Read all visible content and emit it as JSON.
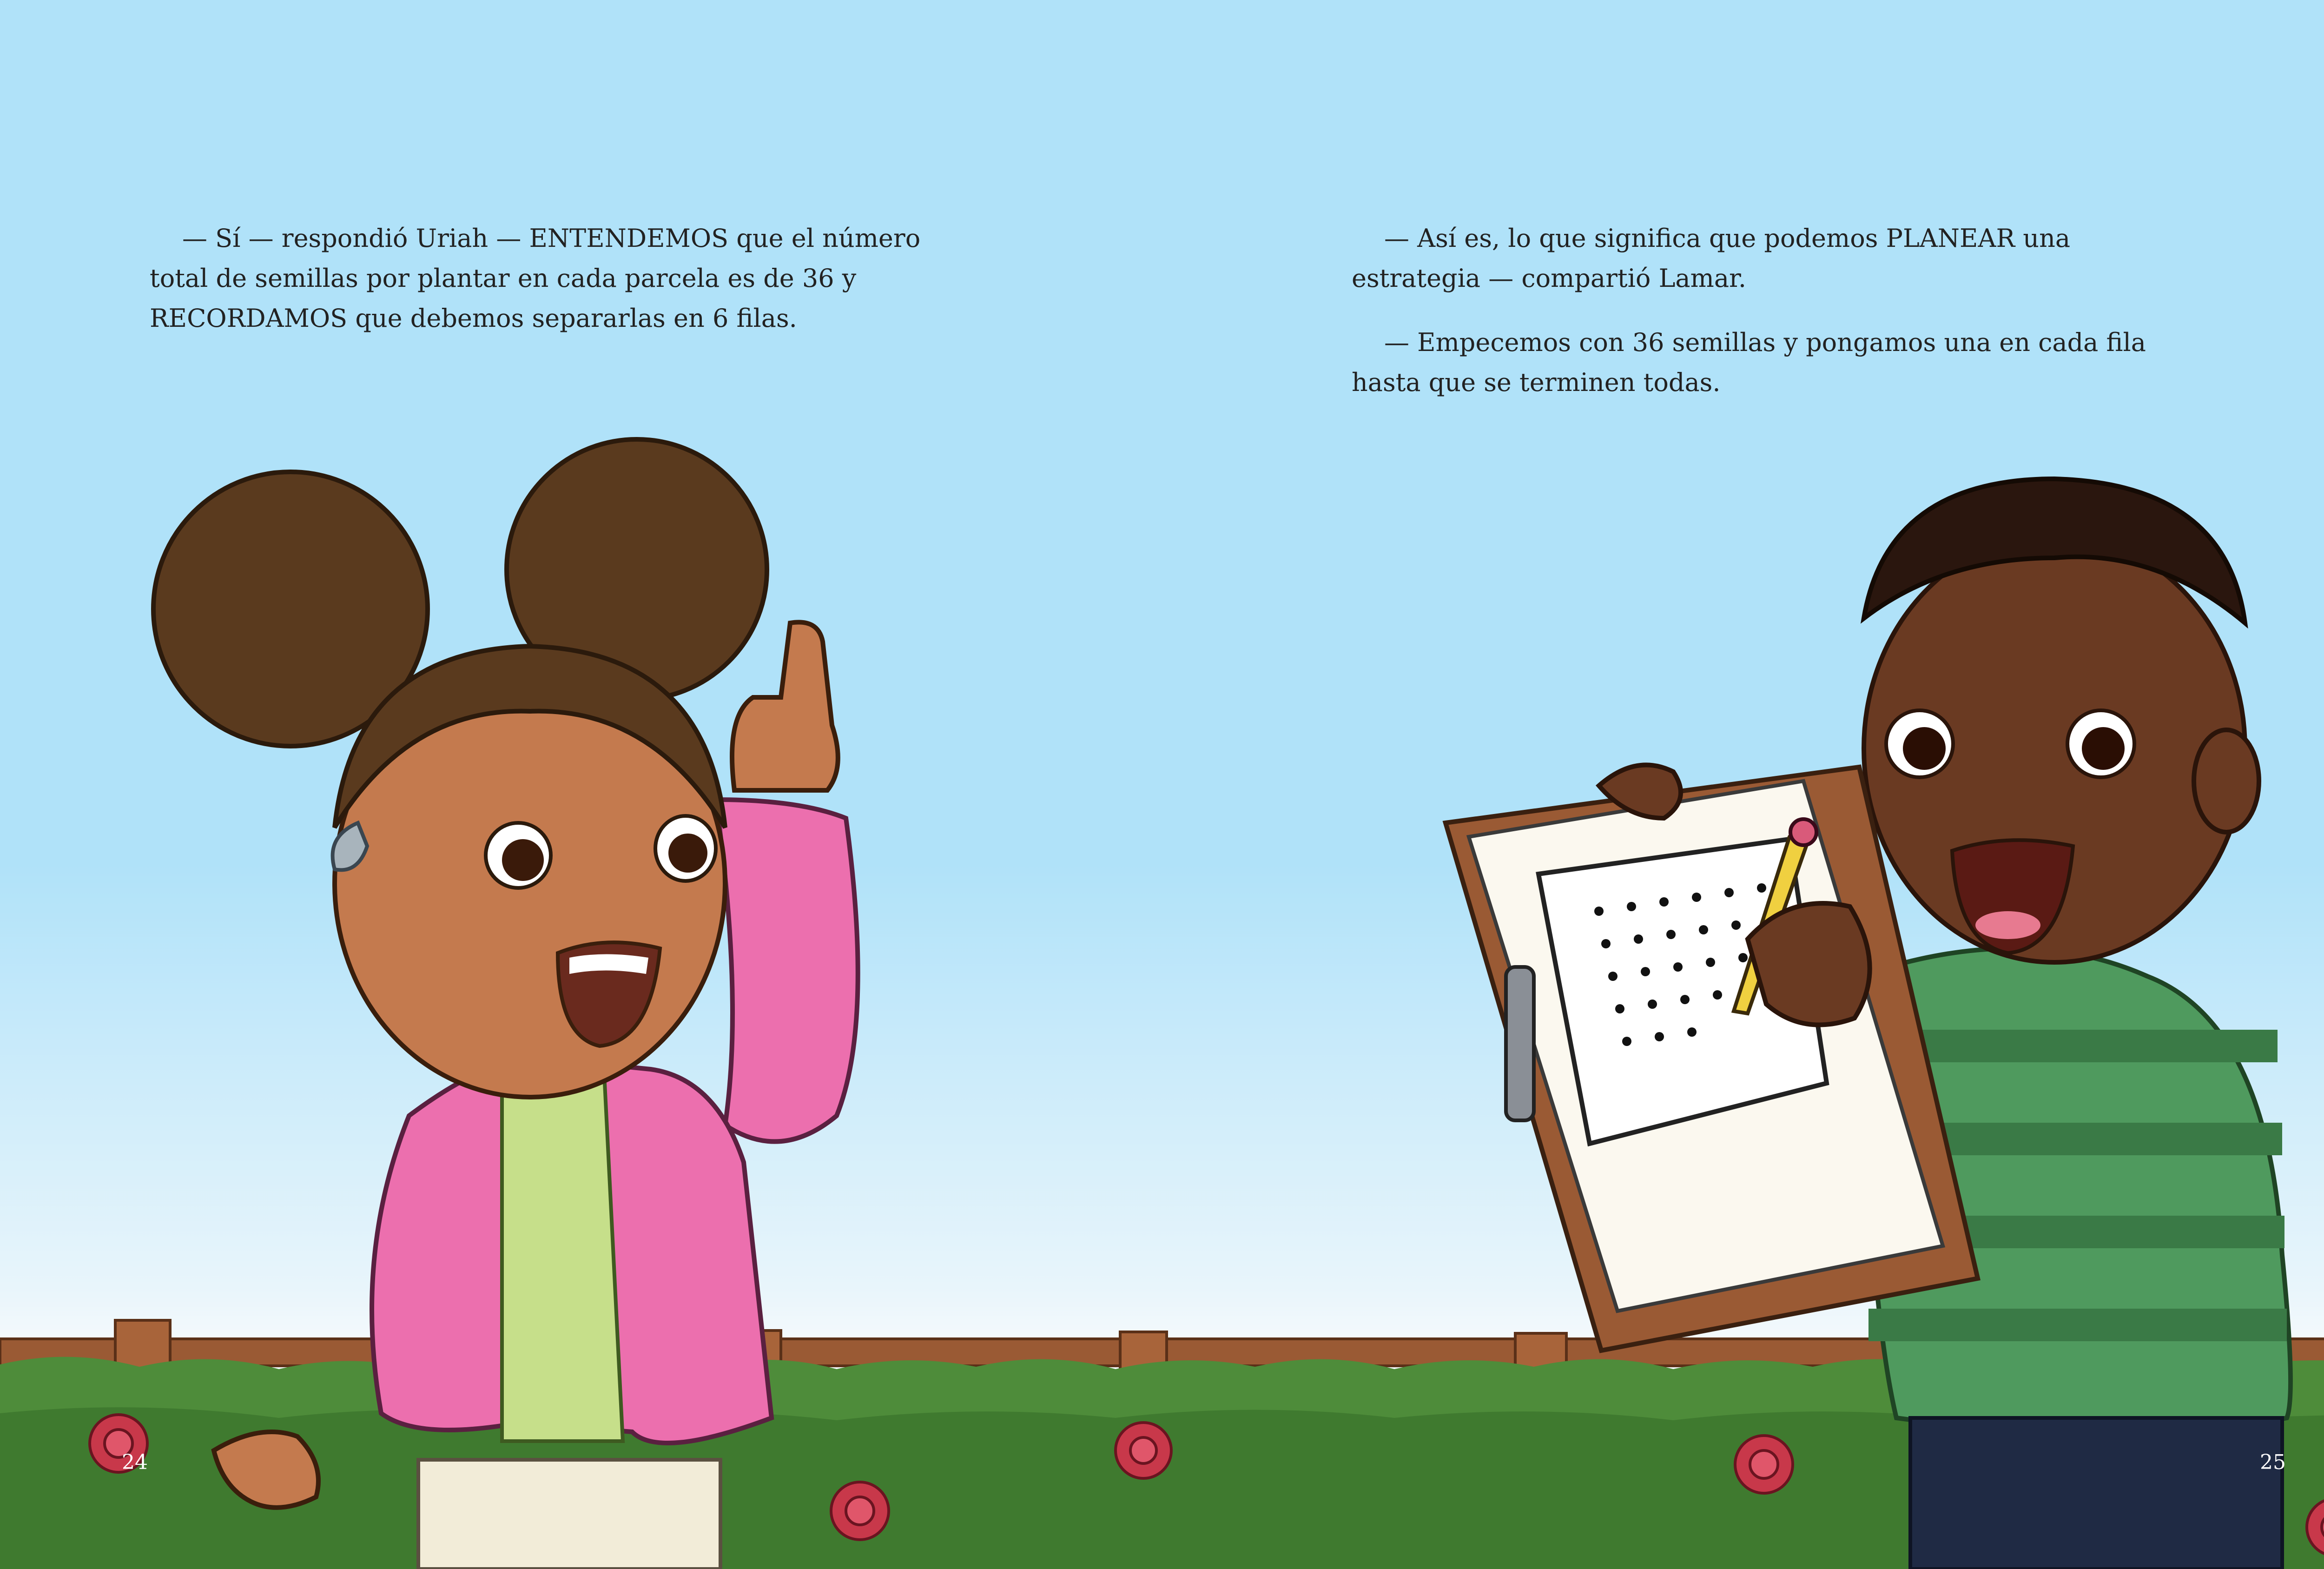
{
  "page_left": {
    "paragraphs": [
      "— Sí — respondió Uriah — ENTENDEMOS que el número total de semillas por plantar en cada parcela es de 36 y RECORDAMOS que debemos separarlas en 6 filas."
    ],
    "page_number": "24"
  },
  "page_right": {
    "paragraphs": [
      "— Así es, lo que significa que podemos PLANEAR una estrategia — compartió Lamar.",
      "— Empecemos con 36 semillas y pongamos una en cada fila hasta que se terminen todas."
    ],
    "page_number": "25"
  },
  "colors": {
    "sky": "#b0e2f9",
    "grass": "#4e8c3a",
    "fence": "#9a5a34",
    "jacket": "#ec6fae",
    "sweater": "#4f9a5e",
    "skin_uriah": "#c47a4e",
    "skin_lamar": "#6a3a22",
    "roses": "#c8384a"
  }
}
